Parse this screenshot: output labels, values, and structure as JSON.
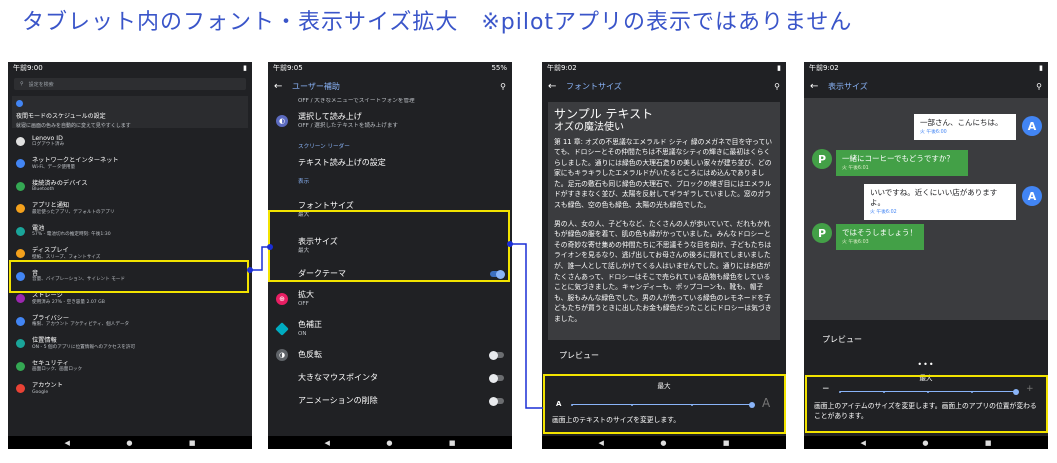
{
  "page_title": "タブレット内のフォント・表示サイズ拡大　※pilotアプリの表示ではありません",
  "colors": {
    "highlight": "#f2e300",
    "connector": "#1a2ed6",
    "accent": "#8ab4f8",
    "bg": "#202124"
  },
  "panel1": {
    "status_time": "午前9:00",
    "search_placeholder": "設定を検索",
    "suggestion": {
      "title": "夜間モードのスケジュールの設定",
      "sub": "就寝に画面の色みを自動的に変えて見やすくします"
    },
    "items": [
      {
        "title": "Lenovo ID",
        "sub": "ログアウト済み",
        "icon": "account-icon",
        "color": "#e0e0e0"
      },
      {
        "title": "ネットワークとインターネット",
        "sub": "Wi-Fi、データ使用量",
        "icon": "wifi-icon",
        "color": "#4285f4"
      },
      {
        "title": "接続済みのデバイス",
        "sub": "Bluetooth",
        "icon": "devices-icon",
        "color": "#34a853"
      },
      {
        "title": "アプリと通知",
        "sub": "最近使ったアプリ、デフォルトのアプリ",
        "icon": "apps-icon",
        "color": "#f4a11c"
      },
      {
        "title": "電池",
        "sub": "57% - 電池切れの推定時刻: 午後1:30",
        "icon": "battery-icon",
        "color": "#1aa59a"
      },
      {
        "title": "ディスプレイ",
        "sub": "壁紙、スリープ、フォントサイズ",
        "icon": "display-icon",
        "color": "#f4a11c"
      },
      {
        "title": "音",
        "sub": "音量、バイブレーション、サイレント モード",
        "icon": "sound-icon",
        "color": "#4285f4"
      },
      {
        "title": "ストレージ",
        "sub": "使用済み 27% - 空き容量 2.07 GB",
        "icon": "storage-icon",
        "color": "#9c27b0"
      },
      {
        "title": "プライバシー",
        "sub": "権限、アカウント アクティビティ、個人データ",
        "icon": "privacy-icon",
        "color": "#4285f4"
      },
      {
        "title": "位置情報",
        "sub": "ON - 5 個のアプリに位置情報へのアクセスを許可",
        "icon": "location-icon",
        "color": "#1aa59a"
      },
      {
        "title": "セキュリティ",
        "sub": "画面ロック、画面ロック",
        "icon": "lock-icon",
        "color": "#34a853"
      },
      {
        "title": "アカウント",
        "sub": "Google",
        "icon": "accounts-icon",
        "color": "#e94235"
      }
    ]
  },
  "panel2": {
    "status_time": "午前9:05",
    "status_battery": "55%",
    "title": "ユーザー補助",
    "top_cut": "OFF / 大きなメニューでスイートフォンを管理",
    "select_to_speak": {
      "title": "選択して読み上げ",
      "sub": "OFF / 選択したテキストを読み上げます"
    },
    "screen_reader_section": "スクリーン リーダー",
    "tts": "テキスト読み上げの設定",
    "display_section": "表示",
    "font_size": {
      "title": "フォントサイズ",
      "sub": "最大"
    },
    "display_size": {
      "title": "表示サイズ",
      "sub": "最大"
    },
    "dark_theme": "ダークテーマ",
    "magnification": {
      "title": "拡大",
      "sub": "OFF"
    },
    "color_correction": {
      "title": "色補正",
      "sub": "ON"
    },
    "color_inversion": "色反転",
    "large_pointer": "大きなマウスポインタ",
    "remove_animations": "アニメーションの削除"
  },
  "panel3": {
    "status_time": "午前9:02",
    "title": "フォントサイズ",
    "sample_title": "サンプル テキスト",
    "sample_sub": "オズの魔法使い",
    "sample_body_1": "第 11 章: オズの不思議なエメラルド シティ 緑のメガネで目を守っていても、ドロシーとその仲間たちは不思議なシティの輝きに最初はくらくらしました。通りには緑色の大理石造りの美しい家々が建ち並び、どの家にもキラキラしたエメラルドがいたるところにはめ込んでありました。足元の敷石も同じ緑色の大理石で、ブロックの継ぎ目にはエメラルドがすきまなく並び、太陽を反射してギラギラしていました。窓のガラスも緑色、空の色も緑色、太陽の光も緑色でした。",
    "sample_body_2": "男の人、女の人、子どもなど、たくさんの人が歩いていて、だれもかれもが緑色の服を着て、肌の色も緑がかっていました。みんなドロシーとその奇妙な寄せ集めの仲間たちに不思議そうな目を向け、子どもたちはライオンを見るなり、逃げ出してお母さんの後ろに隠れてしまいましたが、誰一人として話しかけてくる人はいませんでした。通りにはお店がたくさんあって、ドロシーはそこで売られている品物も緑色をしていることに気づきました。キャンディーも、ポップコーンも、靴も、帽子も、服もみんな緑色でした。男の人が売っている緑色のレモネードを子どもたちが買うときに出したお金も緑色だったことにドロシーは気づきました。",
    "preview": "プレビュー",
    "level": "最大",
    "small_a": "A",
    "large_a": "A",
    "description": "画面上のテキストのサイズを変更します。"
  },
  "panel4": {
    "status_time": "午前9:02",
    "title": "表示サイズ",
    "messages": [
      {
        "text": "一部さん、こんにちは。",
        "time": "火 午後6:00",
        "side": "right",
        "avatar": "A"
      },
      {
        "text": "一緒にコーヒーでもどうですか？",
        "time": "火 午後6:01",
        "side": "left",
        "avatar": "P"
      },
      {
        "text": "いいですね。近くにいい店がありますよ。",
        "time": "火 午後6:02",
        "side": "right",
        "avatar": "A"
      },
      {
        "text": "ではそうしましょう！",
        "time": "火 午後6:03",
        "side": "left",
        "avatar": "P"
      }
    ],
    "preview": "プレビュー",
    "level": "最大",
    "minus": "−",
    "plus": "+",
    "description": "画面上のアイテムのサイズを変更します。画面上のアプリの位置が変わることがあります。"
  },
  "nav": {
    "back": "◀",
    "home": "●",
    "recents": "■"
  }
}
